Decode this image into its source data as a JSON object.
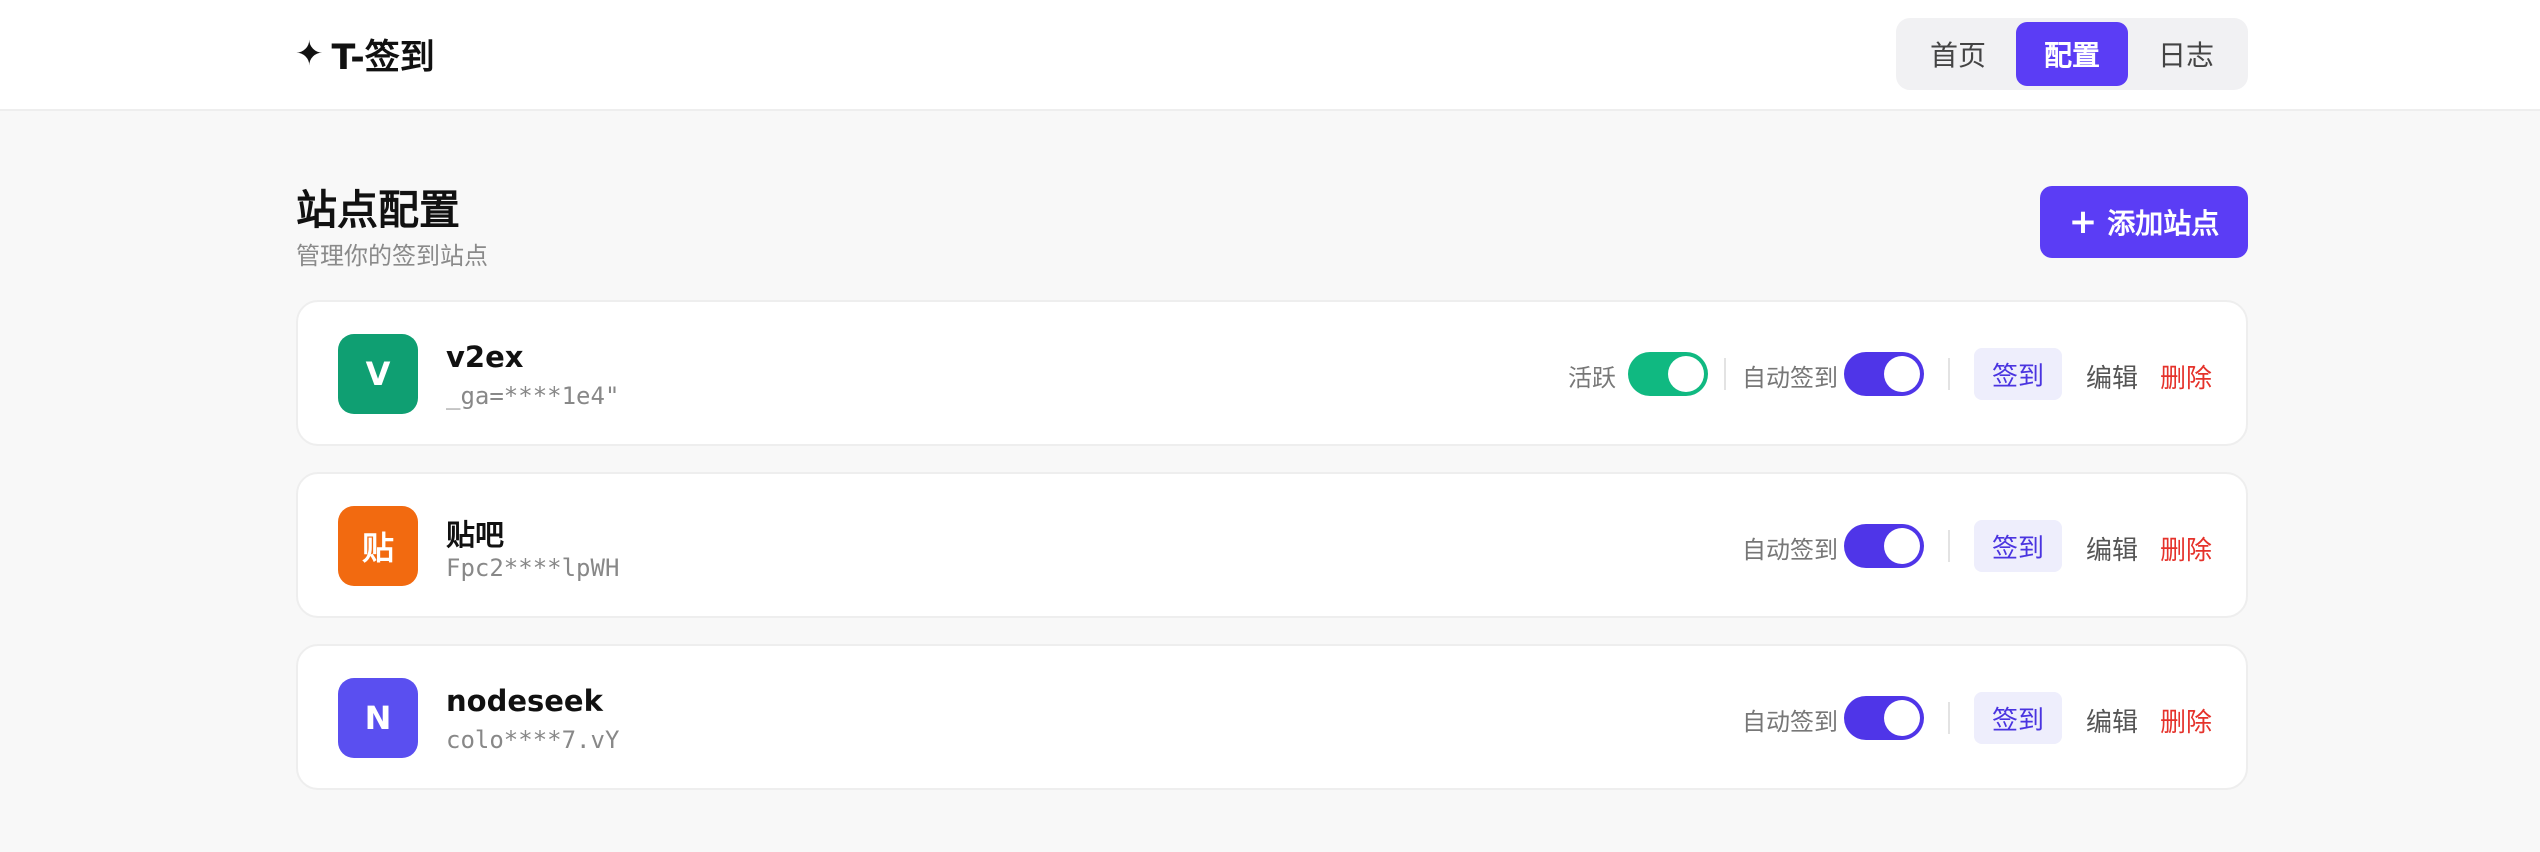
{
  "app": {
    "logo_icon": "✦",
    "title": "T-签到"
  },
  "nav": [
    {
      "label": "首页",
      "active": false
    },
    {
      "label": "配置",
      "active": true
    },
    {
      "label": "日志",
      "active": false
    }
  ],
  "page": {
    "title": "站点配置",
    "subtitle": "管理你的签到站点",
    "add_button_icon": "+",
    "add_button_label": "添加站点"
  },
  "sites": [
    {
      "avatar": "V",
      "avatar_color": "#0f9f72",
      "name": "v2ex",
      "token": "_ga=****1e4\"",
      "active_label": "活跃",
      "active_on": true,
      "auto_label": "自动签到",
      "auto_on": true,
      "sign_label": "签到",
      "edit_label": "编辑",
      "delete_label": "删除"
    },
    {
      "avatar": "贴",
      "avatar_color": "#f26a10",
      "name": "贴吧",
      "token": "Fpc2****lpWH",
      "auto_label": "自动签到",
      "auto_on": true,
      "sign_label": "签到",
      "edit_label": "编辑",
      "delete_label": "删除"
    },
    {
      "avatar": "N",
      "avatar_color": "#5a4ff0",
      "name": "nodeseek",
      "token": "colo****7.vY",
      "auto_label": "自动签到",
      "auto_on": true,
      "sign_label": "签到",
      "edit_label": "编辑",
      "delete_label": "删除"
    }
  ],
  "colors": {
    "accent": "#5b3df5",
    "toggle_active": "#10b981",
    "toggle_auto": "#4f35e8",
    "danger": "#e5322b"
  }
}
